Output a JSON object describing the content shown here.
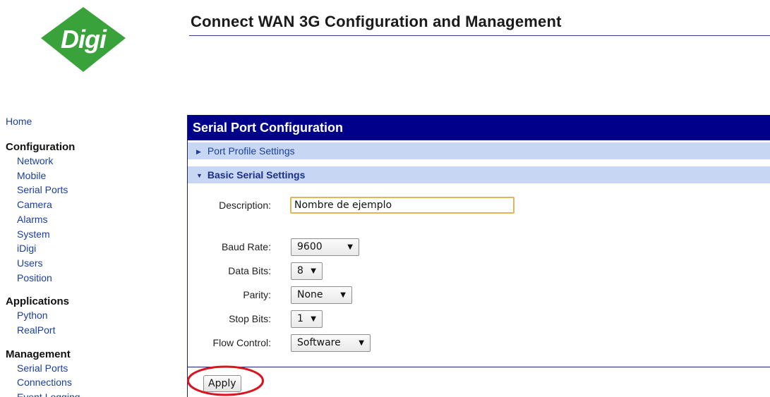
{
  "header": {
    "title": "Connect WAN 3G Configuration and Management",
    "logo_text": "Digi",
    "logo_color": "#3aa23a"
  },
  "sidebar": {
    "home": "Home",
    "sections": [
      {
        "heading": "Configuration",
        "items": [
          "Network",
          "Mobile",
          "Serial Ports",
          "Camera",
          "Alarms",
          "System",
          "iDigi",
          "Users",
          "Position"
        ]
      },
      {
        "heading": "Applications",
        "items": [
          "Python",
          "RealPort"
        ]
      },
      {
        "heading": "Management",
        "items": [
          "Serial Ports",
          "Connections",
          "Event Logging"
        ]
      }
    ]
  },
  "panel": {
    "title": "Serial Port Configuration",
    "title_bg": "#00008a",
    "sections": {
      "port_profile": {
        "label": "Port Profile Settings",
        "icon": "triangle-right-icon"
      },
      "basic_serial": {
        "label": "Basic Serial Settings",
        "icon": "triangle-down-icon"
      }
    },
    "form": {
      "description": {
        "label": "Description:",
        "value": "Nombre de ejemplo"
      },
      "baud_rate": {
        "label": "Baud Rate:",
        "value": "9600"
      },
      "data_bits": {
        "label": "Data Bits:",
        "value": "8"
      },
      "parity": {
        "label": "Parity:",
        "value": "None"
      },
      "stop_bits": {
        "label": "Stop Bits:",
        "value": "1"
      },
      "flow_control": {
        "label": "Flow Control:",
        "value": "Software"
      }
    },
    "apply_label": "Apply",
    "highlight_color": "#d9141e"
  }
}
